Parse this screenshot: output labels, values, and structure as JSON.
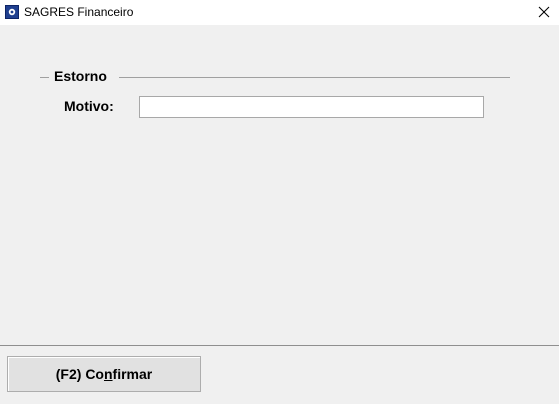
{
  "window": {
    "title": "SAGRES Financeiro",
    "icon": "app-logo-icon",
    "close_icon": "close-icon"
  },
  "estorno": {
    "group_title": "Estorno",
    "motivo_label": "Motivo:",
    "motivo_value": ""
  },
  "footer": {
    "confirm_prefix": "(F2) Co",
    "confirm_mnemonic": "n",
    "confirm_suffix": "firmar"
  }
}
